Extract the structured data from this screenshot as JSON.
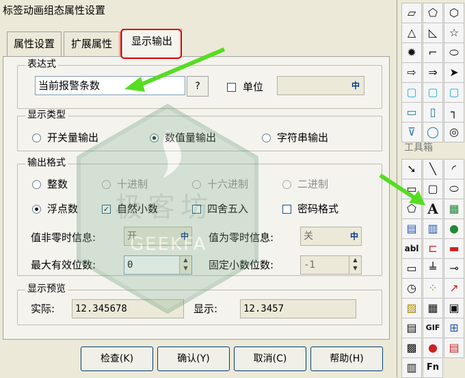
{
  "window": {
    "title": "标签动画组态属性设置"
  },
  "tabs": [
    {
      "label": "属性设置",
      "active": false
    },
    {
      "label": "扩展属性",
      "active": false
    },
    {
      "label": "显示输出",
      "active": true
    }
  ],
  "expression": {
    "legend": "表达式",
    "value": "当前报警条数",
    "help_button": "?",
    "unit_label": "单位",
    "unit_value": ""
  },
  "display_type": {
    "legend": "显示类型",
    "options": [
      "开关量输出",
      "数值量输出",
      "字符串输出"
    ],
    "selected": "数值量输出"
  },
  "output_format": {
    "legend": "输出格式",
    "base_options": [
      "整数",
      "十进制",
      "十六进制",
      "二进制"
    ],
    "float_label": "浮点数",
    "natural_decimal_label": "自然小数",
    "round_label": "四舍五入",
    "password_label": "密码格式",
    "nonzero_label": "值非零时信息:",
    "nonzero_value": "开",
    "zero_label": "值为零时信息:",
    "zero_value": "关",
    "max_digits_label": "最大有效位数:",
    "max_digits_value": "0",
    "fixed_decimals_label": "固定小数位数:",
    "fixed_decimals_value": "-1",
    "dd_icon": "中"
  },
  "preview": {
    "legend": "显示预览",
    "actual_label": "实际:",
    "actual_value": "12.345678",
    "display_label": "显示:",
    "display_value": "12.3457"
  },
  "buttons": {
    "check": "检查(K)",
    "confirm": "确认(Y)",
    "cancel": "取消(C)",
    "help": "帮助(H)"
  },
  "toolbox": {
    "title": "工具箱",
    "gif_label": "GIF",
    "fn_label": "Fn",
    "abl_label": "abl"
  },
  "watermark": {
    "text_cn": "极客坊",
    "text_en": "GEEKFA"
  },
  "colors": {
    "highlight_red": "#e00000",
    "arrow_green": "#55dd22"
  }
}
